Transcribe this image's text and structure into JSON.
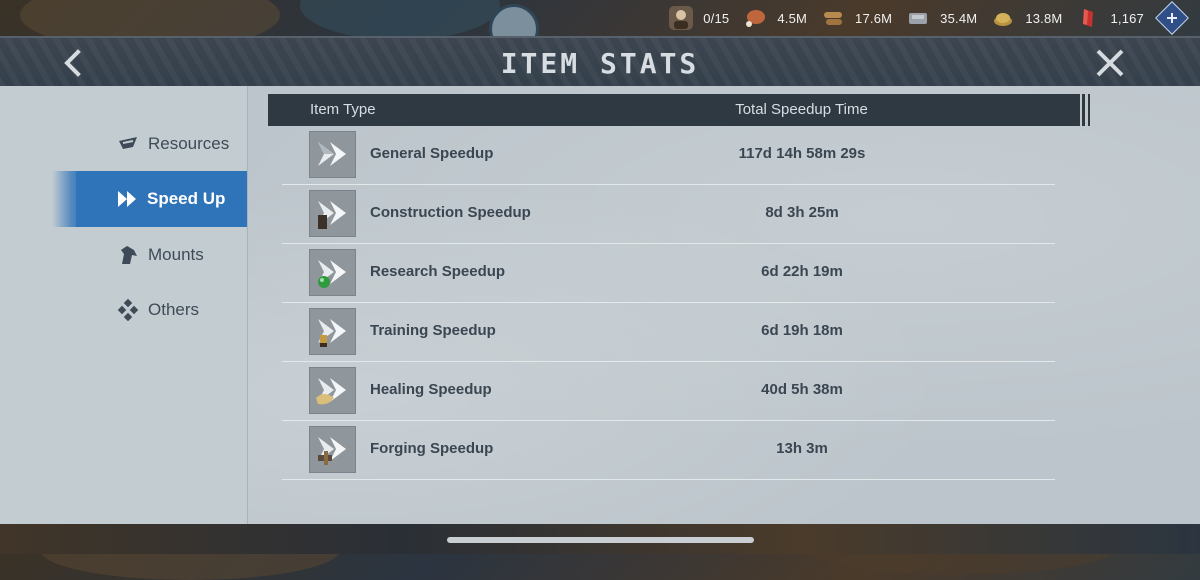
{
  "app": {
    "title": "ITEM STATS"
  },
  "resources": [
    {
      "icon": "leader-portrait-icon",
      "value": "0/15",
      "color": "#6b5a4a"
    },
    {
      "icon": "meat-icon",
      "value": "4.5M",
      "color": "#c0663c"
    },
    {
      "icon": "wood-icon",
      "value": "17.6M",
      "color": "#b98a4f"
    },
    {
      "icon": "stone-icon",
      "value": "35.4M",
      "color": "#9aa1a8"
    },
    {
      "icon": "gold-icon",
      "value": "13.8M",
      "color": "#d3b25a"
    },
    {
      "icon": "red-gem-icon",
      "value": "1,167",
      "color": "#c8322e"
    }
  ],
  "header": {
    "back_icon": "chevron-left-icon",
    "close_icon": "close-icon"
  },
  "sidebar": {
    "items": [
      {
        "label": "Resources",
        "icon": "resources-icon",
        "active": false
      },
      {
        "label": "Speed Up",
        "icon": "speedup-icon",
        "active": true
      },
      {
        "label": "Mounts",
        "icon": "horse-icon",
        "active": false
      },
      {
        "label": "Others",
        "icon": "others-icon",
        "active": false
      }
    ],
    "accent": "#2f73b8"
  },
  "table": {
    "headers": {
      "type": "Item Type",
      "time": "Total Speedup Time"
    },
    "rows": [
      {
        "name": "General Speedup",
        "time": "117d 14h 58m 29s",
        "icon": "general-speedup-icon"
      },
      {
        "name": "Construction Speedup",
        "time": "8d 3h 25m",
        "icon": "construction-speedup-icon"
      },
      {
        "name": "Research Speedup",
        "time": "6d 22h 19m",
        "icon": "research-speedup-icon"
      },
      {
        "name": "Training Speedup",
        "time": "6d 19h 18m",
        "icon": "training-speedup-icon"
      },
      {
        "name": "Healing Speedup",
        "time": "40d 5h 38m",
        "icon": "healing-speedup-icon"
      },
      {
        "name": "Forging Speedup",
        "time": "13h 3m",
        "icon": "forging-speedup-icon"
      }
    ]
  }
}
